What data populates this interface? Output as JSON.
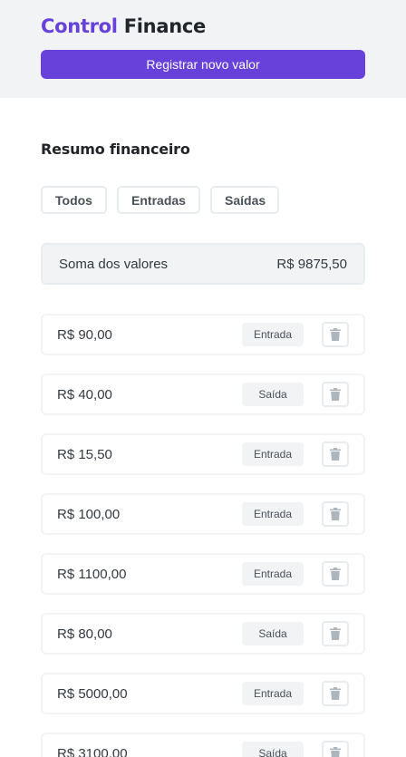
{
  "header": {
    "brand_accent": "Control",
    "brand_rest": " Finance",
    "register_label": "Registrar novo valor"
  },
  "summary_section": {
    "title": "Resumo financeiro",
    "filters": [
      "Todos",
      "Entradas",
      "Saídas"
    ],
    "sum_label": "Soma dos valores",
    "sum_value": "R$ 9875,50"
  },
  "entries": [
    {
      "value": "R$ 90,00",
      "type": "Entrada"
    },
    {
      "value": "R$ 40,00",
      "type": "Saída"
    },
    {
      "value": "R$ 15,50",
      "type": "Entrada"
    },
    {
      "value": "R$ 100,00",
      "type": "Entrada"
    },
    {
      "value": "R$ 1100,00",
      "type": "Entrada"
    },
    {
      "value": "R$ 80,00",
      "type": "Saída"
    },
    {
      "value": "R$ 5000,00",
      "type": "Entrada"
    },
    {
      "value": "R$ 3100,00",
      "type": "Saída"
    }
  ],
  "colors": {
    "accent": "#6741d9",
    "header_bg": "#f1f3f5"
  }
}
